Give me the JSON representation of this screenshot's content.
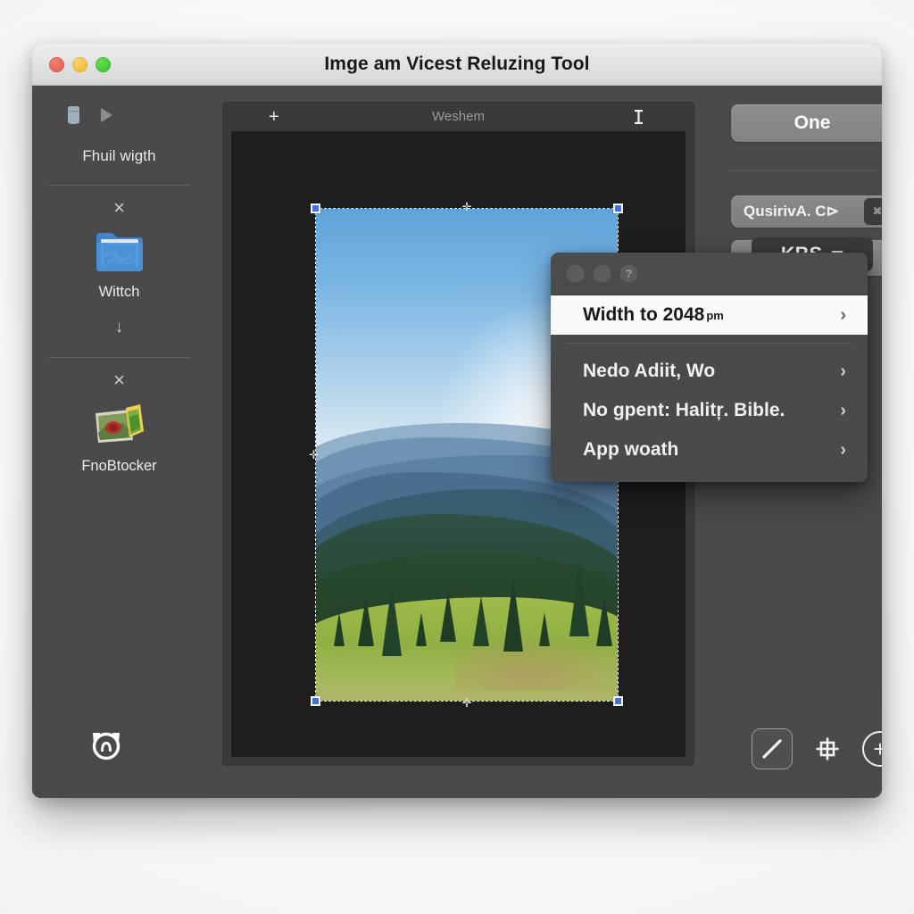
{
  "window": {
    "title": "Imge am Vicest Reluzing Tool",
    "traffic_lights": [
      "close",
      "minimize",
      "zoom"
    ]
  },
  "sidebar": {
    "top_icons": [
      "tag-icon",
      "play-icon"
    ],
    "heading": "Fhuil wigth",
    "items": [
      {
        "label": "Wittch",
        "icon": "folder-icon",
        "close": "×"
      },
      {
        "label": "FnoBtocker",
        "icon": "photo-icon",
        "close": "×"
      }
    ],
    "arrow_down": "↓",
    "bottom_icon": "alarm-clock-icon"
  },
  "canvas": {
    "add_label": "+",
    "title": "Weshem",
    "cursor_icon": "text-ibeam-icon",
    "selection": {
      "handles": [
        "top-left",
        "top-right",
        "bottom-left",
        "bottom-right"
      ],
      "mid_handles": [
        "top",
        "right",
        "bottom",
        "left"
      ],
      "image_alt": "mountain landscape with forest and meadow"
    }
  },
  "right_panel": {
    "primary_button": "One",
    "field": {
      "value": "QusirivA. C⊳",
      "badge": "⌘"
    },
    "dropdown": {
      "label": "KBS",
      "caret": "▾"
    },
    "tools": [
      {
        "name": "line-tool",
        "glyph": "/"
      },
      {
        "name": "grid-tool",
        "glyph": "⌗"
      },
      {
        "name": "add-tool",
        "glyph": "+"
      }
    ]
  },
  "popup": {
    "titlebar_buttons": [
      "dot",
      "dot",
      "help"
    ],
    "help_glyph": "?",
    "items": [
      {
        "label": "Width to 2048",
        "sub": "pm",
        "chevron": "›",
        "active": true
      },
      {
        "label": "Nedo Adiit, Wo",
        "sub": "",
        "chevron": "›",
        "active": false
      },
      {
        "label": "No gpent: Halitŗ. Bible.",
        "sub": "",
        "chevron": "›",
        "active": false
      },
      {
        "label": "App woath",
        "sub": "",
        "chevron": "›",
        "active": false
      }
    ]
  },
  "colors": {
    "window_bg": "#4a4a4a",
    "canvas_bg": "#1e1e1e",
    "accent_handle": "#3f6fe0",
    "menu_active_bg": "#fafafa"
  }
}
